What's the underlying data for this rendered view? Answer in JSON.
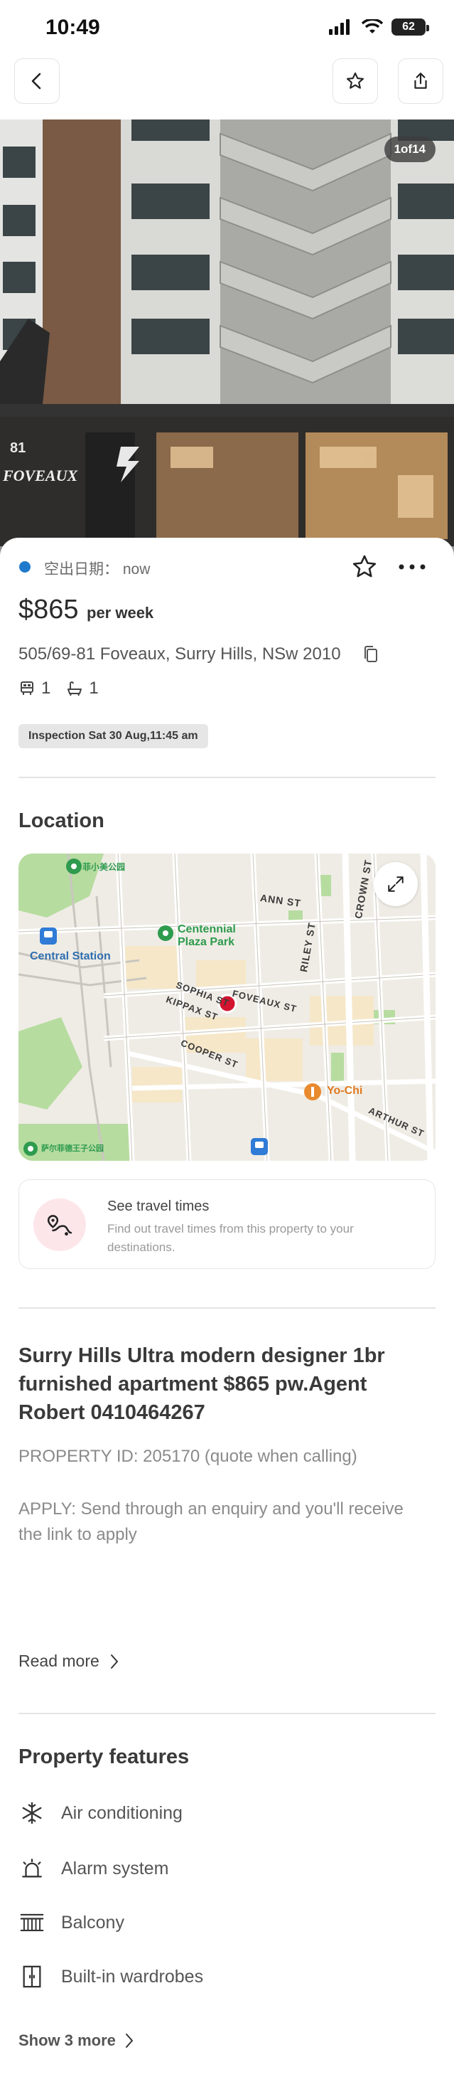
{
  "status": {
    "time": "10:49",
    "battery": "62"
  },
  "photo": {
    "counter": "1of14",
    "sign_number": "81",
    "sign_name": "FOVEAUX"
  },
  "listing": {
    "availability_label": "空出日期：",
    "availability_value": "now",
    "price": "$865",
    "price_unit": "per week",
    "address": "505/69-81 Foveaux, Surry Hills, NSw 2010",
    "bedrooms": "1",
    "bathrooms": "1",
    "inspection": "Inspection Sat 30 Aug,11:45 am"
  },
  "location": {
    "title": "Location",
    "map_labels": {
      "park_top": "菲小美公园",
      "ann_st": "ANN ST",
      "crown_st": "CROWN ST",
      "riley_st": "RILEY ST",
      "centennial": "Centennial",
      "plaza_park": "Plaza Park",
      "central_station": "Central Station",
      "sophia_st": "SOPHIA ST",
      "foveaux_st": "FOVEAUX ST",
      "kippax_st": "KIPPAX ST",
      "cooper_st": "COOPER ST",
      "yo_chi": "Yo-Chi",
      "arthur_st": "ARTHUR ST",
      "park_bottom": "萨尔菲德王子公园"
    },
    "travel_title": "See travel times",
    "travel_sub": "Find out travel times from this property to your destinations."
  },
  "description": {
    "headline": "Surry Hills Ultra modern designer 1br furnished apartment $865 pw.Agent Robert 0410464267",
    "property_id": "PROPERTY ID: 205170 (quote when calling)",
    "apply": "APPLY: Send through an enquiry and you'll receive the link to apply",
    "read_more": "Read more"
  },
  "features": {
    "title": "Property features",
    "items": [
      {
        "label": "Air conditioning",
        "icon": "snowflake-icon"
      },
      {
        "label": "Alarm system",
        "icon": "alarm-icon"
      },
      {
        "label": "Balcony",
        "icon": "balcony-icon"
      },
      {
        "label": "Built-in wardrobes",
        "icon": "wardrobe-icon"
      }
    ],
    "show_more": "Show 3 more"
  },
  "colors": {
    "accent_blue": "#1f7acc",
    "pin_red": "#d3142f",
    "text": "#2b2b2b"
  }
}
